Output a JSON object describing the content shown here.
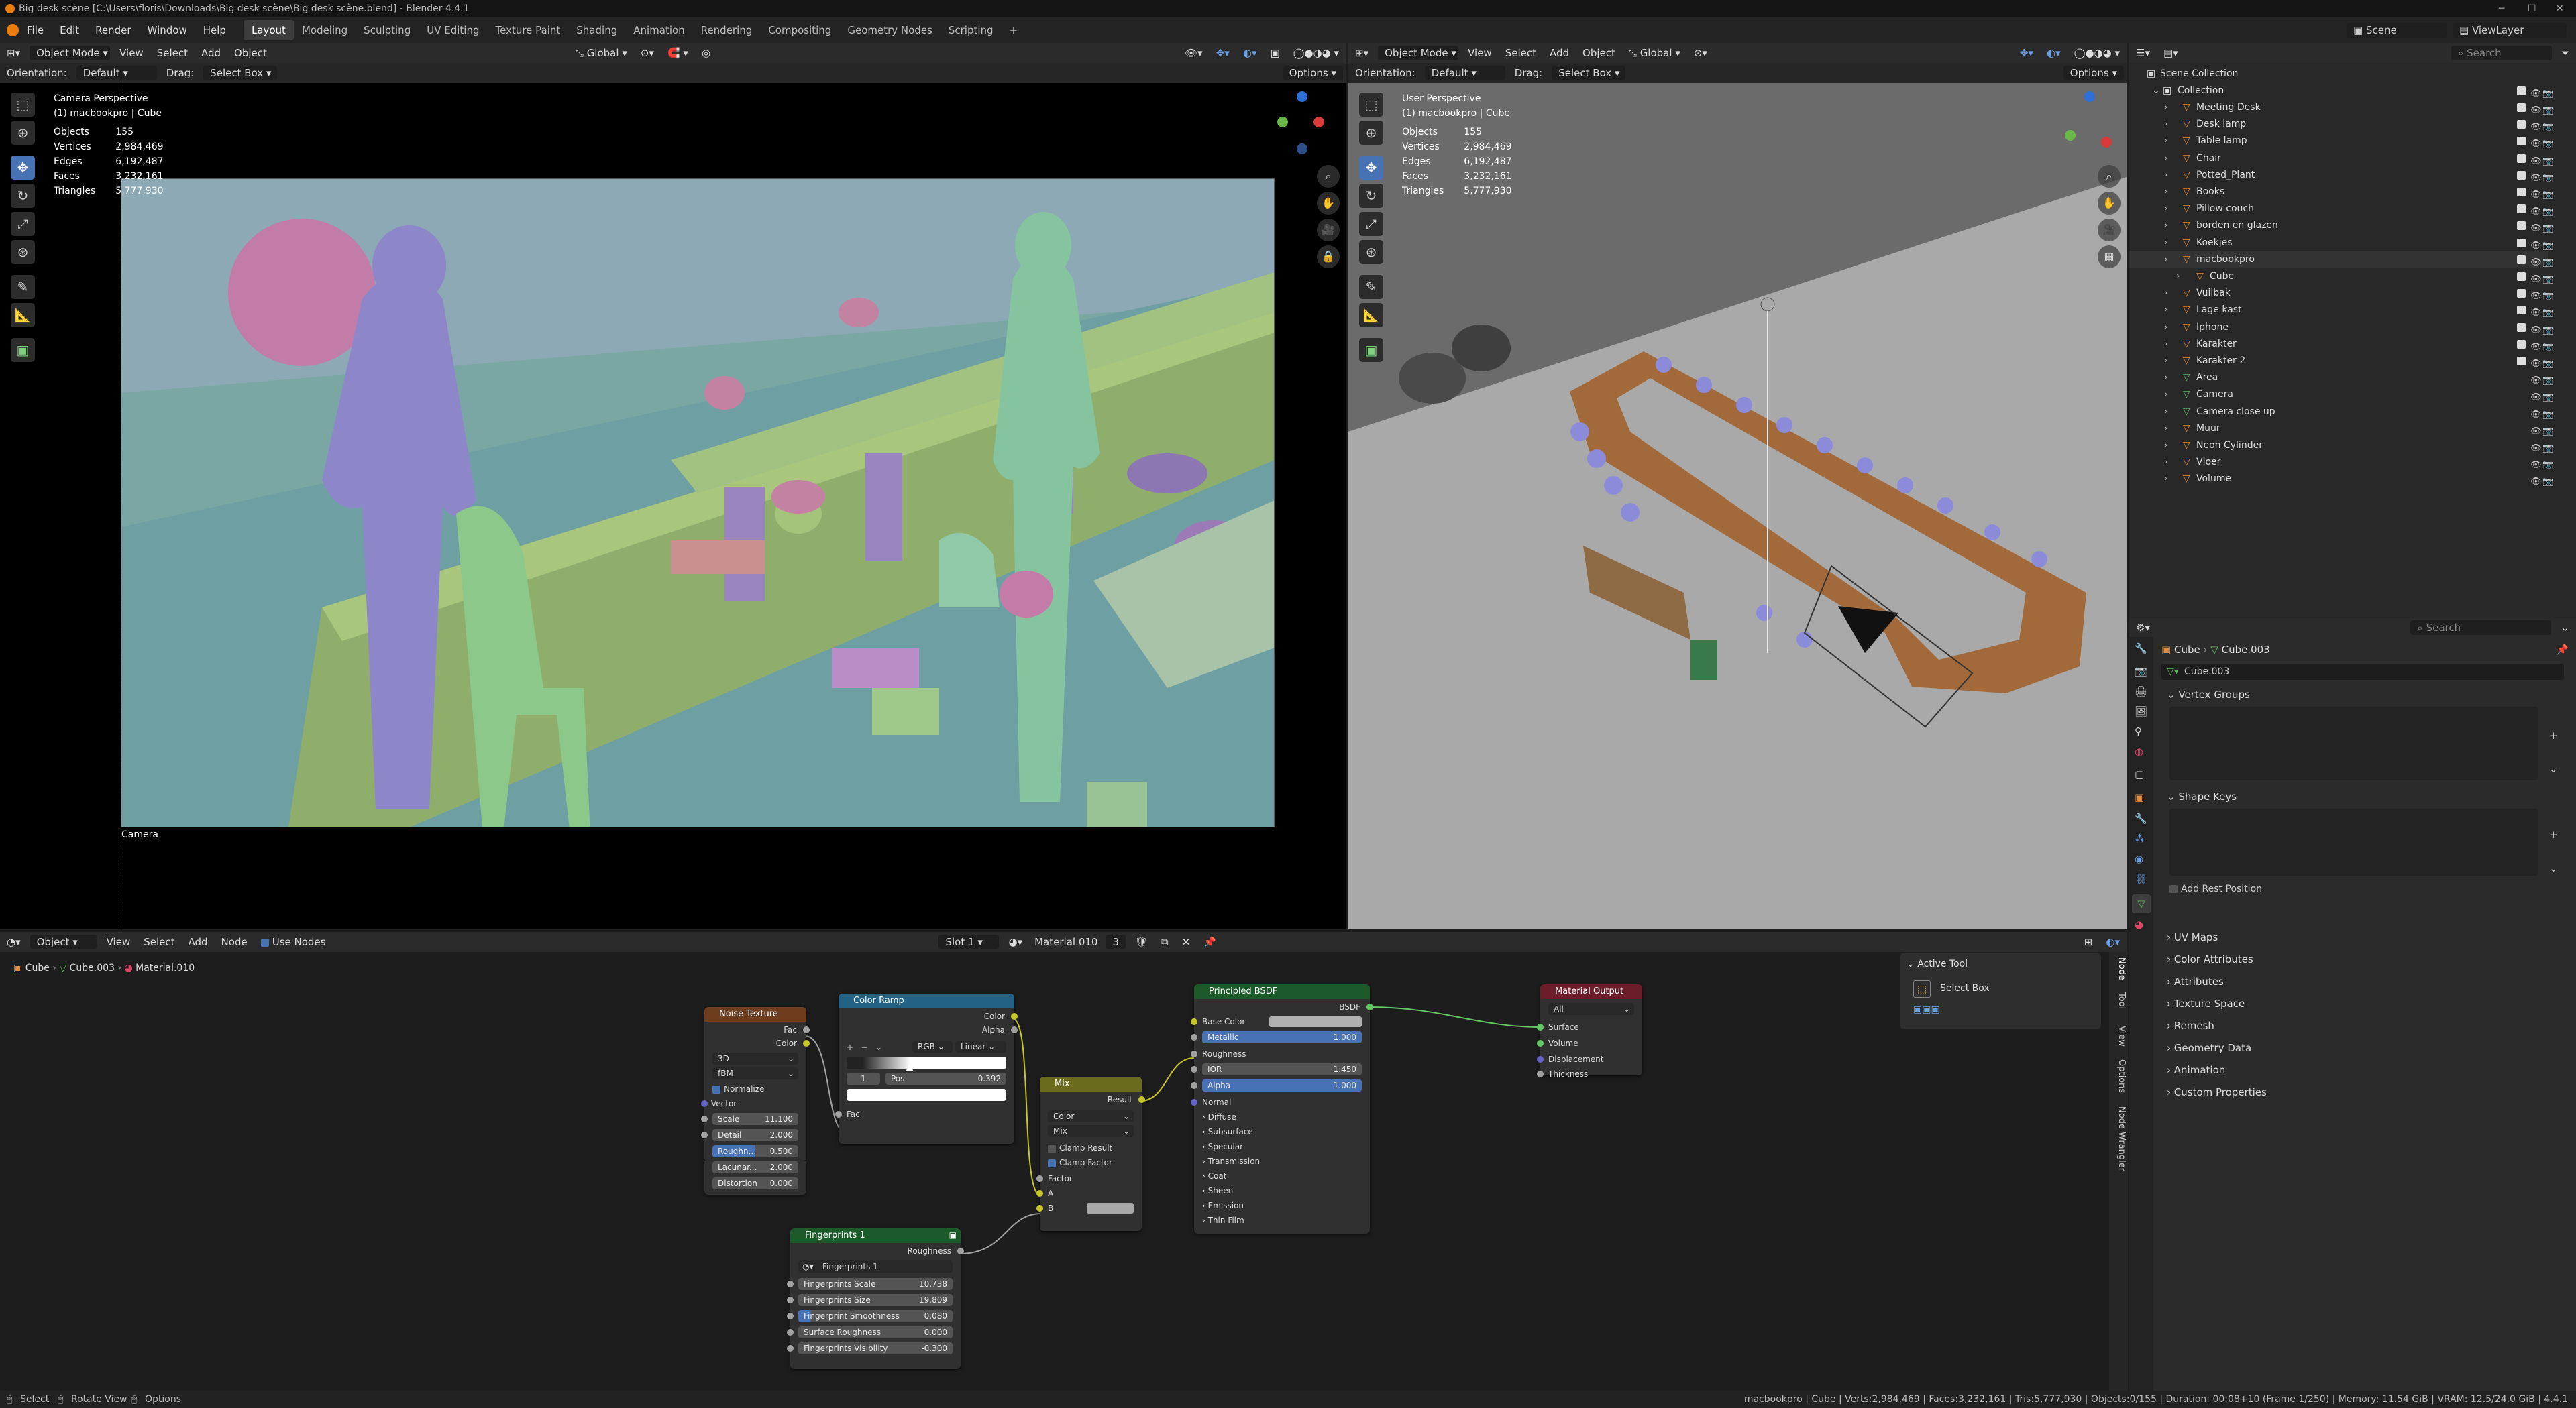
{
  "window": {
    "title": "Big desk scène [C:\\Users\\floris\\Downloads\\Big desk scène\\Big desk scène.blend] - Blender 4.4.1"
  },
  "menu": {
    "items": [
      "File",
      "Edit",
      "Render",
      "Window",
      "Help"
    ]
  },
  "workspaces": [
    "Layout",
    "Modeling",
    "Sculpting",
    "UV Editing",
    "Texture Paint",
    "Shading",
    "Animation",
    "Rendering",
    "Compositing",
    "Geometry Nodes",
    "Scripting"
  ],
  "active_workspace": "Layout",
  "topright": {
    "scene": "Scene",
    "viewlayer": "ViewLayer"
  },
  "viewport_left": {
    "mode": "Object Mode",
    "menus": [
      "View",
      "Select",
      "Add",
      "Object"
    ],
    "transform": "Global",
    "options": "Options",
    "orientation_label": "Orientation:",
    "orientation": "Default",
    "drag_label": "Drag:",
    "drag": "Select Box",
    "title": "Camera Perspective",
    "subtitle": "(1) macbookpro | Cube",
    "stats": [
      [
        "Objects",
        "155"
      ],
      [
        "Vertices",
        "2,984,469"
      ],
      [
        "Edges",
        "6,192,487"
      ],
      [
        "Faces",
        "3,232,161"
      ],
      [
        "Triangles",
        "5,777,930"
      ]
    ],
    "camera_label": "Camera"
  },
  "viewport_right": {
    "mode": "Object Mode",
    "menus": [
      "View",
      "Select",
      "Add",
      "Object"
    ],
    "transform": "Global",
    "options": "Options",
    "orientation_label": "Orientation:",
    "orientation": "Default",
    "drag_label": "Drag:",
    "drag": "Select Box",
    "title": "User Perspective",
    "subtitle": "(1) macbookpro | Cube",
    "stats": [
      [
        "Objects",
        "155"
      ],
      [
        "Vertices",
        "2,984,469"
      ],
      [
        "Edges",
        "6,192,487"
      ],
      [
        "Faces",
        "3,232,161"
      ],
      [
        "Triangles",
        "5,777,930"
      ]
    ]
  },
  "outliner": {
    "search_placeholder": "Search",
    "root": "Scene Collection",
    "collection": "Collection",
    "items": [
      {
        "name": "Meeting Desk",
        "color": "#e08c3c"
      },
      {
        "name": "Desk lamp",
        "color": "#e08c3c"
      },
      {
        "name": "Table lamp",
        "color": "#e08c3c"
      },
      {
        "name": "Chair",
        "color": "#e08c3c"
      },
      {
        "name": "Potted_Plant",
        "color": "#e08c3c"
      },
      {
        "name": "Books",
        "color": "#e08c3c"
      },
      {
        "name": "Pillow couch",
        "color": "#e08c3c"
      },
      {
        "name": "borden en glazen",
        "color": "#e08c3c"
      },
      {
        "name": "Koekjes",
        "color": "#e08c3c"
      },
      {
        "name": "macbookpro",
        "color": "#e08c3c"
      },
      {
        "name": "Cube",
        "color": "#e08c3c"
      },
      {
        "name": "Vuilbak",
        "color": "#e08c3c"
      },
      {
        "name": "Lage kast",
        "color": "#e08c3c"
      },
      {
        "name": "Iphone",
        "color": "#e08c3c"
      },
      {
        "name": "Karakter",
        "color": "#e08c3c"
      },
      {
        "name": "Karakter 2",
        "color": "#e08c3c"
      },
      {
        "name": "Area",
        "color": "#5cb85c"
      },
      {
        "name": "Camera",
        "color": "#5cb85c"
      },
      {
        "name": "Camera close up",
        "color": "#5cb85c"
      },
      {
        "name": "Muur",
        "color": "#e08c3c"
      },
      {
        "name": "Neon Cylinder",
        "color": "#e08c3c"
      },
      {
        "name": "Vloer",
        "color": "#e08c3c"
      },
      {
        "name": "Volume",
        "color": "#e08c3c"
      }
    ]
  },
  "properties": {
    "search_placeholder": "Search",
    "breadcrumb": [
      "Cube",
      "Cube.003"
    ],
    "mesh_name": "Cube.003",
    "sections": [
      "Vertex Groups",
      "Shape Keys",
      "UV Maps",
      "Color Attributes",
      "Attributes",
      "Texture Space",
      "Remesh",
      "Geometry Data",
      "Animation",
      "Custom Properties"
    ],
    "add_rest_position": "Add Rest Position"
  },
  "node_editor": {
    "editor_type": "Object",
    "menus": [
      "View",
      "Select",
      "Add",
      "Node"
    ],
    "use_nodes": "Use Nodes",
    "slot": "Slot 1",
    "material": "Material.010",
    "users": "3",
    "breadcrumb": [
      "Cube",
      "Cube.003",
      "Material.010"
    ],
    "sidebar_tabs": [
      "Node",
      "Tool",
      "View",
      "Options",
      "Node Wrangler"
    ],
    "active_tool": {
      "title": "Active Tool",
      "tool": "Select Box"
    },
    "nodes": {
      "noise": {
        "title": "Noise Texture",
        "out_fac": "Fac",
        "out_color": "Color",
        "dim": "3D",
        "type": "fBM",
        "normalize": "Normalize",
        "vector": "Vector",
        "fields": [
          [
            "Scale",
            "11.100"
          ],
          [
            "Detail",
            "2.000"
          ],
          [
            "Roughn...",
            "0.500"
          ],
          [
            "Lacunar...",
            "2.000"
          ],
          [
            "Distortion",
            "0.000"
          ]
        ]
      },
      "ramp": {
        "title": "Color Ramp",
        "out_color": "Color",
        "out_alpha": "Alpha",
        "mode": "RGB",
        "interp": "Linear",
        "index": "1",
        "pos_label": "Pos",
        "pos": "0.392",
        "in_fac": "Fac"
      },
      "mix": {
        "title": "Mix",
        "out_result": "Result",
        "type": "Color",
        "blend": "Mix",
        "clamp_result": "Clamp Result",
        "clamp_factor": "Clamp Factor",
        "factor": "Factor",
        "a": "A",
        "b": "B"
      },
      "bsdf": {
        "title": "Principled BSDF",
        "out": "BSDF",
        "base_color": "Base Color",
        "metallic": [
          "Metallic",
          "1.000"
        ],
        "roughness": "Roughness",
        "ior": [
          "IOR",
          "1.450"
        ],
        "alpha": [
          "Alpha",
          "1.000"
        ],
        "normal": "Normal",
        "panels": [
          "Diffuse",
          "Subsurface",
          "Specular",
          "Transmission",
          "Coat",
          "Sheen",
          "Emission",
          "Thin Film"
        ]
      },
      "output": {
        "title": "Material Output",
        "target": "All",
        "inputs": [
          "Surface",
          "Volume",
          "Displacement",
          "Thickness"
        ]
      },
      "fingerprints": {
        "title": "Fingerprints 1",
        "out": "Roughness",
        "group": "Fingerprints 1",
        "fields": [
          [
            "Fingerprints Scale",
            "10.738"
          ],
          [
            "Fingerprints Size",
            "19.809"
          ],
          [
            "Fingerprint Smoothness",
            "0.080"
          ],
          [
            "Surface Roughness",
            "0.000"
          ],
          [
            "Fingerprints Visibility",
            "-0.300"
          ]
        ]
      }
    }
  },
  "status": {
    "left": [
      "Select",
      "Rotate View",
      "Options"
    ],
    "right": "macbookpro | Cube | Verts:2,984,469 | Faces:3,232,161 | Tris:5,777,930 | Objects:0/155 | Duration: 00:08+10 (Frame 1/250) | Memory: 11.54 GiB | VRAM: 12.5/24.0 GiB | 4.4.1"
  }
}
